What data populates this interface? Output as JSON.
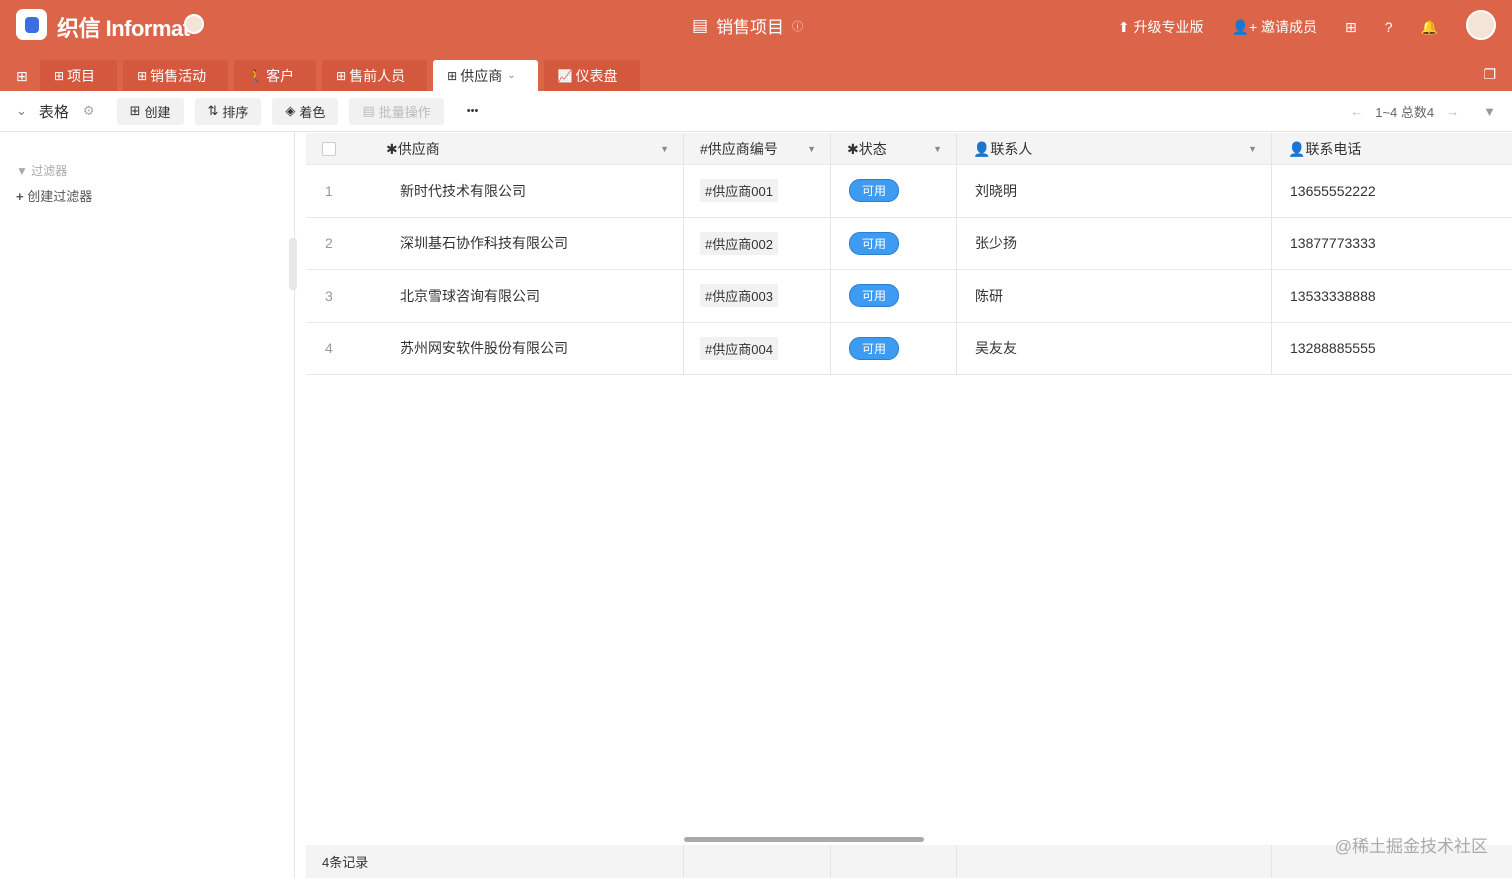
{
  "header": {
    "brand": "织信 Informat",
    "title": "销售项目",
    "upgrade": "升级专业版",
    "invite": "邀请成员"
  },
  "tabs": [
    {
      "label": "项目",
      "icon": "grid-icon"
    },
    {
      "label": "销售活动",
      "icon": "grid-icon"
    },
    {
      "label": "客户",
      "icon": "walk-icon"
    },
    {
      "label": "售前人员",
      "icon": "grid-icon"
    },
    {
      "label": "供应商",
      "icon": "grid-icon",
      "active": true
    },
    {
      "label": "仪表盘",
      "icon": "chart-icon"
    }
  ],
  "toolbar": {
    "view": "表格",
    "create": "创建",
    "sort": "排序",
    "color": "着色",
    "batch": "批量操作",
    "more": "•••",
    "pager": "1~4 总数4"
  },
  "filter": {
    "title": "过滤器",
    "create": "创建过滤器"
  },
  "columns": [
    "供应商",
    "供应商编号",
    "状态",
    "联系人",
    "联系电话"
  ],
  "rows": [
    {
      "n": "1",
      "name": "新时代技术有限公司",
      "code": "#供应商001",
      "status": "可用",
      "contact": "刘晓明",
      "phone": "13655552222"
    },
    {
      "n": "2",
      "name": "深圳基石协作科技有限公司",
      "code": "#供应商002",
      "status": "可用",
      "contact": "张少扬",
      "phone": "13877773333"
    },
    {
      "n": "3",
      "name": "北京雪球咨询有限公司",
      "code": "#供应商003",
      "status": "可用",
      "contact": "陈研",
      "phone": "13533338888"
    },
    {
      "n": "4",
      "name": "苏州网安软件股份有限公司",
      "code": "#供应商004",
      "status": "可用",
      "contact": "吴友友",
      "phone": "13288885555"
    }
  ],
  "footer": {
    "count": "4条记录"
  },
  "watermark": "@稀土掘金技术社区",
  "colors": {
    "brand": "#dc6449",
    "status": "#3d9cf2"
  }
}
